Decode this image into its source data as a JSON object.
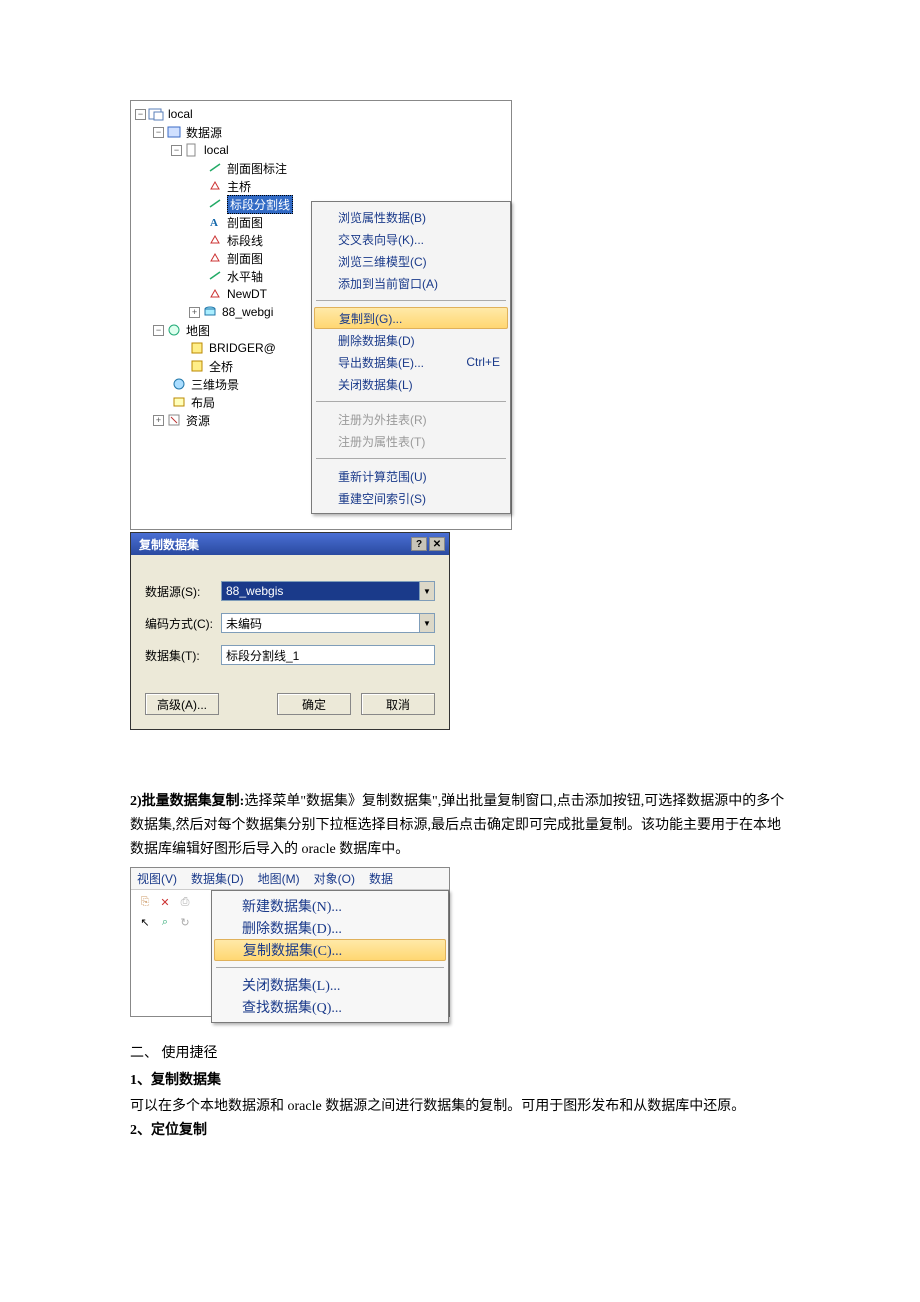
{
  "tree": {
    "n0": "local",
    "n1": "数据源",
    "n2": "local",
    "n3": "剖面图标注",
    "n4": "主桥",
    "n5": "标段分割线",
    "n6": "剖面图",
    "n7": "标段线",
    "n8": "剖面图",
    "n9": "水平轴",
    "n10": "NewDT",
    "n11": "88_webgi",
    "n12": "地图",
    "n13": "BRIDGER@",
    "n14": "全桥",
    "n15": "三维场景",
    "n16": "布局",
    "n17": "资源"
  },
  "context_menu": {
    "browse_attr": "浏览属性数据(B)",
    "cross_wizard": "交叉表向导(K)...",
    "browse_3d": "浏览三维模型(C)",
    "add_to_window": "添加到当前窗口(A)",
    "copy_to": "复制到(G)...",
    "delete_ds": "删除数据集(D)",
    "export_ds": "导出数据集(E)...",
    "export_sc": "Ctrl+E",
    "close_ds": "关闭数据集(L)",
    "reg_ext": "注册为外挂表(R)",
    "reg_attr": "注册为属性表(T)",
    "recalc": "重新计算范围(U)",
    "rebuild": "重建空间索引(S)"
  },
  "dialog": {
    "title": "复制数据集",
    "label_ds_source": "数据源(S):",
    "value_ds_source": "88_webgis",
    "label_encoding": "编码方式(C):",
    "value_encoding": "未编码",
    "label_dsname": "数据集(T):",
    "value_dsname": "标段分割线_1",
    "btn_adv": "高级(A)...",
    "btn_ok": "确定",
    "btn_cancel": "取消"
  },
  "para2": {
    "lead": "2)批量数据集复制:",
    "body": "选择菜单\"数据集》复制数据集\",弹出批量复制窗口,点击添加按钮,可选择数据源中的多个数据集,然后对每个数据集分别下拉框选择目标源,最后点击确定即可完成批量复制。该功能主要用于在本地数据库编辑好图形后导入的 oracle 数据库中。"
  },
  "menubar": {
    "view": "视图(V)",
    "dataset": "数据集(D)",
    "map": "地图(M)",
    "object": "对象(O)",
    "data": "数据"
  },
  "dropdown": {
    "new": "新建数据集(N)...",
    "del": "删除数据集(D)...",
    "copy": "复制数据集(C)...",
    "close": "关闭数据集(L)...",
    "find": "查找数据集(Q)..."
  },
  "section2": {
    "head": "二、     使用捷径",
    "item1_no": "1、",
    "item1_t": "复制数据集",
    "item1_b": "可以在多个本地数据源和 oracle 数据源之间进行数据集的复制。可用于图形发布和从数据库中还原。",
    "item2_no": "2、",
    "item2_t": "定位复制"
  }
}
